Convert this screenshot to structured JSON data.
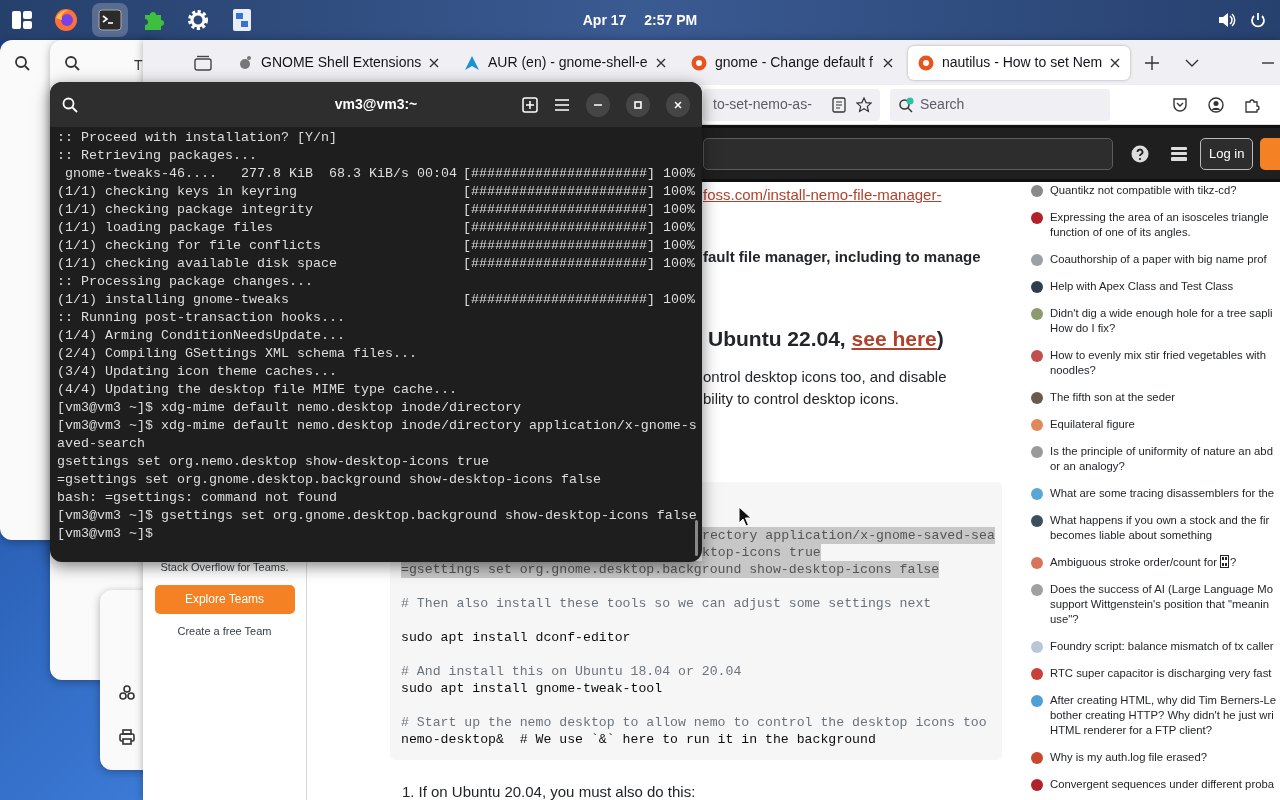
{
  "top_bar": {
    "dock": [
      {
        "kind": "app-grid",
        "selected": false
      },
      {
        "kind": "firefox",
        "selected": false
      },
      {
        "kind": "terminal",
        "selected": true
      },
      {
        "kind": "extensions",
        "selected": false
      },
      {
        "kind": "settings",
        "selected": false
      },
      {
        "kind": "app",
        "selected": false
      }
    ],
    "date": "Apr 17",
    "time": "2:57 PM"
  },
  "back_windows": [
    {
      "icons": [
        {
          "kind": "search"
        }
      ]
    },
    {
      "icons": [
        {
          "kind": "search"
        }
      ],
      "text": "T"
    },
    {
      "icons": [
        {
          "kind": "cluster"
        },
        {
          "kind": "printer"
        }
      ]
    }
  ],
  "browser": {
    "tabs": [
      {
        "label": "GNOME Shell Extensions",
        "kind": "gnome",
        "selected": false
      },
      {
        "label": "AUR (en) - gnome-shell-e",
        "kind": "aur",
        "selected": false
      },
      {
        "label": "gnome - Change default f",
        "kind": "askubuntu",
        "selected": false
      },
      {
        "label": "nautilus - How to set Nem",
        "kind": "askubuntu",
        "selected": true
      }
    ],
    "url": "to-set-nemo-as-",
    "search_placeholder": "Search"
  },
  "site_header": {
    "login": "Log in"
  },
  "left_nav": {
    "teams_text": "Stack Overflow for Teams.",
    "explore": "Explore Teams",
    "create": "Create a free Team"
  },
  "article": {
    "link": "foss.com/install-nemo-file-manager-",
    "bold_text": "fault file manager, including to manage",
    "heading": {
      "text_before": "Ubuntu 22.04, ",
      "link": "see here",
      "text_after": ")"
    },
    "paragraph_lines": [
      "ontrol desktop icons too, and disable",
      "bility to control desktop icons."
    ],
    "code_blocks": [
      [
        {
          "text": "rectory application/x-gnome-saved-sea",
          "kind": "covered",
          "highlighted": true
        },
        {
          "text": "ktop-icons true",
          "kind": "covered",
          "highlighted": true
        },
        {
          "text": "=gsettings set org.gnome.desktop.background show-desktop-icons false",
          "kind": "code",
          "highlighted": true
        }
      ],
      [
        {
          "text": "# Then also install these tools so we can adjust some settings next",
          "kind": "comment",
          "highlighted": false
        }
      ],
      [
        {
          "text": "sudo apt install dconf-editor",
          "kind": "code",
          "highlighted": false
        }
      ],
      [
        {
          "text": "# And install this on Ubuntu 18.04 or 20.04",
          "kind": "comment",
          "highlighted": false
        },
        {
          "text": "sudo apt install gnome-tweak-tool",
          "kind": "code",
          "highlighted": false
        }
      ],
      [
        {
          "text": "# Start up the nemo desktop to allow nemo to control the desktop icons too",
          "kind": "comment",
          "highlighted": false
        },
        {
          "text": "nemo-desktop&  # We use `&` here to run it in the background",
          "kind": "code",
          "highlighted": false
        }
      ]
    ],
    "list_items": [
      {
        "number": "1.",
        "text": "If on Ubuntu 20.04, you must also do this:"
      }
    ]
  },
  "sidebar_questions": [
    {
      "text": "Quantikz not compatible with tikz-cd?",
      "color": "#8a8a8a"
    },
    {
      "text": "Expressing the area of an isosceles triangle\nfunction of one of its angles.",
      "color": "#b3202a"
    },
    {
      "text": "Coauthorship of a paper with big name prof",
      "color": "#9aa0a6"
    },
    {
      "text": "Help with Apex Class and Test Class",
      "color": "#2f3e4b"
    },
    {
      "text": "Didn't dig a wide enough hole for a tree sapli\nHow do I fix?",
      "color": "#8c9a6e"
    },
    {
      "text": "How to evenly mix stir fried vegetables with\nnoodles?",
      "color": "#c0504d"
    },
    {
      "text": "The fifth son at the seder",
      "color": "#6b5a4a"
    },
    {
      "text": "Equilateral figure",
      "color": "#e0885a"
    },
    {
      "text": "Is the principle of uniformity of nature an abd\nor an analogy?",
      "color": "#9a9a9a"
    },
    {
      "text": "What are some tracing disassemblers for the",
      "color": "#5aa7d6"
    },
    {
      "text": "What happens if you own a stock and the fir\nbecomes liable about something",
      "color": "#3d4f5c"
    },
    {
      "text": "Ambiguous stroke order/count for",
      "after_glyph": "?",
      "color": "#d8745a"
    },
    {
      "text": "Does the success of AI (Large Language Mo\nsupport Wittgenstein's position that \"meanin\nuse\"?",
      "color": "#a0a0a0"
    },
    {
      "text": "Foundry script: balance mismatch of tx caller",
      "color": "#b8c6d8"
    },
    {
      "text": "RTC super capacitor is discharging very fast",
      "color": "#c9403a"
    },
    {
      "text": "After creating HTML, why did Tim Berners-Le\nbother creating HTTP? Why didn't he just wri\nHTML renderer for a FTP client?",
      "color": "#4f9fd4"
    },
    {
      "text": "Why is my auth.log file erased?",
      "color": "#c9472e"
    },
    {
      "text": "Convergent sequences under different proba",
      "color": "#b3202a"
    }
  ],
  "terminal": {
    "title": "vm3@vm3:~",
    "lines": [
      {
        "text": ":: Proceed with installation? [Y/n]"
      },
      {
        "text": ":: Retrieving packages..."
      },
      {
        "text": " gnome-tweaks-46....   277.8 KiB  68.3 KiB/s 00:04",
        "progress": "[######################] 100%"
      },
      {
        "text": "(1/1) checking keys in keyring",
        "progress": "[######################] 100%"
      },
      {
        "text": "(1/1) checking package integrity",
        "progress": "[######################] 100%"
      },
      {
        "text": "(1/1) loading package files",
        "progress": "[######################] 100%"
      },
      {
        "text": "(1/1) checking for file conflicts",
        "progress": "[######################] 100%"
      },
      {
        "text": "(1/1) checking available disk space",
        "progress": "[######################] 100%"
      },
      {
        "text": ":: Processing package changes..."
      },
      {
        "text": "(1/1) installing gnome-tweaks",
        "progress": "[######################] 100%"
      },
      {
        "text": ":: Running post-transaction hooks..."
      },
      {
        "text": "(1/4) Arming ConditionNeedsUpdate..."
      },
      {
        "text": "(2/4) Compiling GSettings XML schema files..."
      },
      {
        "text": "(3/4) Updating icon theme caches..."
      },
      {
        "text": "(4/4) Updating the desktop file MIME type cache..."
      },
      {
        "text": "[vm3@vm3 ~]$ xdg-mime default nemo.desktop inode/directory"
      },
      {
        "text": "[vm3@vm3 ~]$ xdg-mime default nemo.desktop inode/directory application/x-gnome-s"
      },
      {
        "text": "aved-search"
      },
      {
        "text": "gsettings set org.nemo.desktop show-desktop-icons true"
      },
      {
        "text": "=gsettings set org.gnome.desktop.background show-desktop-icons false"
      },
      {
        "text": "bash: =gsettings: command not found"
      },
      {
        "text": "[vm3@vm3 ~]$ gsettings set org.gnome.desktop.background show-desktop-icons false"
      },
      {
        "text": "[vm3@vm3 ~]$"
      }
    ]
  }
}
